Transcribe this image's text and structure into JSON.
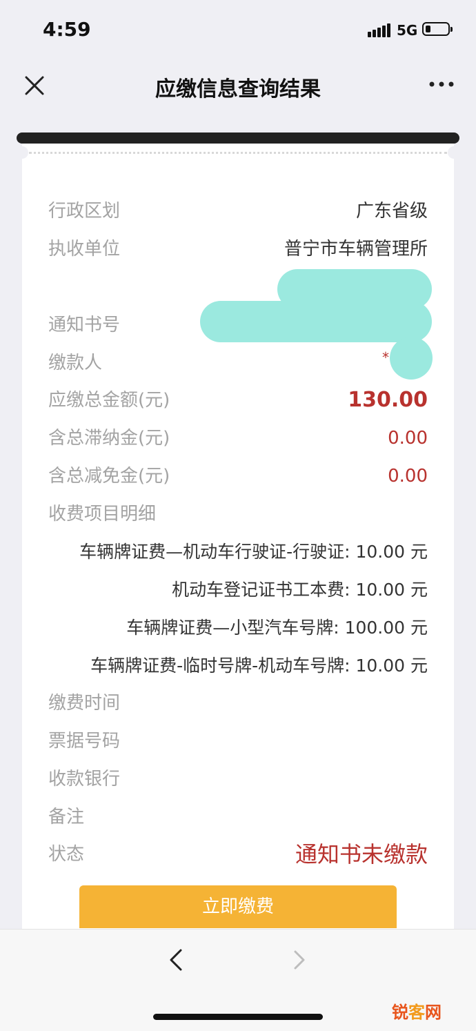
{
  "status_bar": {
    "time": "4:59",
    "network": "5G"
  },
  "nav": {
    "title": "应缴信息查询结果"
  },
  "fields": {
    "region": {
      "label": "行政区划",
      "value": "广东省级"
    },
    "unit": {
      "label": "执收单位",
      "value": "普宁市车辆管理所"
    },
    "notice_no": {
      "label": "通知书号"
    },
    "payer": {
      "label": "缴款人",
      "mask": "*"
    },
    "total": {
      "label": "应缴总金额(元)",
      "value": "130.00"
    },
    "late_fee": {
      "label": "含总滞纳金(元)",
      "value": "0.00"
    },
    "waiver": {
      "label": "含总减免金(元)",
      "value": "0.00"
    },
    "detail": {
      "label": "收费项目明细"
    },
    "pay_time": {
      "label": "缴费时间"
    },
    "receipt_no": {
      "label": "票据号码"
    },
    "bank": {
      "label": "收款银行"
    },
    "remark": {
      "label": "备注"
    },
    "status": {
      "label": "状态",
      "value": "通知书未缴款"
    }
  },
  "fee_items": [
    "车辆牌证费—机动车行驶证-行驶证: 10.00 元",
    "机动车登记证书工本费: 10.00 元",
    "车辆牌证费—小型汽车号牌: 100.00 元",
    "车辆牌证费-临时号牌-机动车号牌: 10.00 元"
  ],
  "pay_button": "立即缴费",
  "watermark": {
    "part1": "锐",
    "part2": "客",
    "part3": "网"
  },
  "colors": {
    "accent_red": "#b8322e",
    "pay_button": "#f5b335",
    "redaction": "#9be9df"
  },
  "icons": [
    "close-icon",
    "more-icon",
    "back-icon",
    "forward-icon",
    "signal-icon",
    "battery-icon"
  ]
}
